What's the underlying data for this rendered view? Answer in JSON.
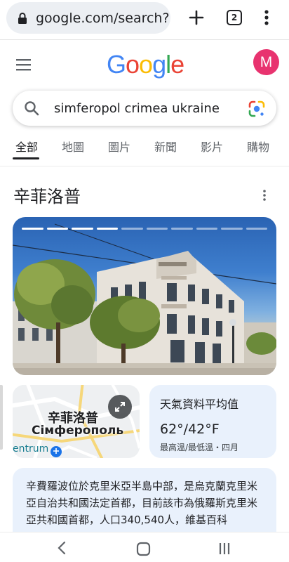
{
  "browser": {
    "url": "google.com/search?",
    "tab_count": "2",
    "lock_icon": "lock-icon",
    "new_tab_icon": "plus-icon",
    "menu_icon": "vertical-dots-icon"
  },
  "google": {
    "logo_letters": [
      "G",
      "o",
      "o",
      "g",
      "l",
      "e"
    ],
    "logo_colors": [
      "#4285F4",
      "#EA4335",
      "#FBBC05",
      "#4285F4",
      "#34A853",
      "#EA4335"
    ],
    "avatar_letter": "M",
    "avatar_color": "#e8336f",
    "menu_icon": "hamburger-icon"
  },
  "search": {
    "query": "simferopol crimea ukraine",
    "search_icon": "search-icon",
    "lens_icon": "google-lens-icon"
  },
  "tabs": [
    {
      "label": "全部",
      "active": true
    },
    {
      "label": "地圖",
      "active": false
    },
    {
      "label": "圖片",
      "active": false
    },
    {
      "label": "新聞",
      "active": false
    },
    {
      "label": "影片",
      "active": false
    },
    {
      "label": "購物",
      "active": false
    }
  ],
  "knowledge_panel": {
    "title": "辛菲洛普",
    "hero_slides_total": 10,
    "hero_slides_viewed": 4,
    "map": {
      "label_zh": "辛菲洛普",
      "label_ru": "Сімферополь",
      "poi_text": "entrum"
    },
    "weather": {
      "title": "天氣資料平均值",
      "temp": "62°/42°F",
      "sub": "最高溫/最低溫・四月"
    },
    "description": "辛費羅波位於克里米亞半島中部，是烏克蘭克里米亞自治共和國法定首都，目前該市為俄羅斯克里米亞共和國首都，人口340,540人，維基百科"
  },
  "navbar": {
    "back_icon": "back-chevron-icon",
    "home_icon": "home-icon",
    "recent_icon": "recent-apps-icon"
  }
}
